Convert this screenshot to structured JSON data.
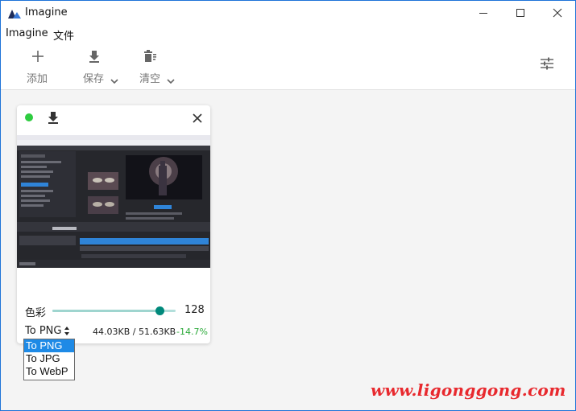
{
  "window": {
    "title": "Imagine",
    "controls": [
      "minimize-icon",
      "maximize-icon",
      "close-icon"
    ]
  },
  "menu": {
    "items": [
      {
        "label": "Imagine"
      },
      {
        "label": "文件"
      }
    ]
  },
  "toolbar": {
    "add_label": "添加",
    "save_label": "保存",
    "clear_label": "清空",
    "icons": [
      "plus-icon",
      "download-icon",
      "trash-icon",
      "settings-sliders-icon"
    ]
  },
  "card": {
    "status_color": "#2ecc40",
    "slider_label": "色彩",
    "slider_value": "128",
    "slider_level": 0.87,
    "format_value": "To PNG",
    "size_text": "44.03KB / 51.63KB",
    "percent_text": "-14.7%"
  },
  "format_dropdown": {
    "options": [
      "To PNG",
      "To JPG",
      "To WebP"
    ],
    "selected_index": 0
  },
  "watermark": "www.ligonggong.com",
  "colors": {
    "accent": "#1e73d8",
    "slider_thumb": "#00897b",
    "slider_track": "#b2dfdb",
    "dropdown_selected": "#1e8ae6",
    "saving_green": "#2eaa3c",
    "watermark_red": "#e8292e"
  }
}
